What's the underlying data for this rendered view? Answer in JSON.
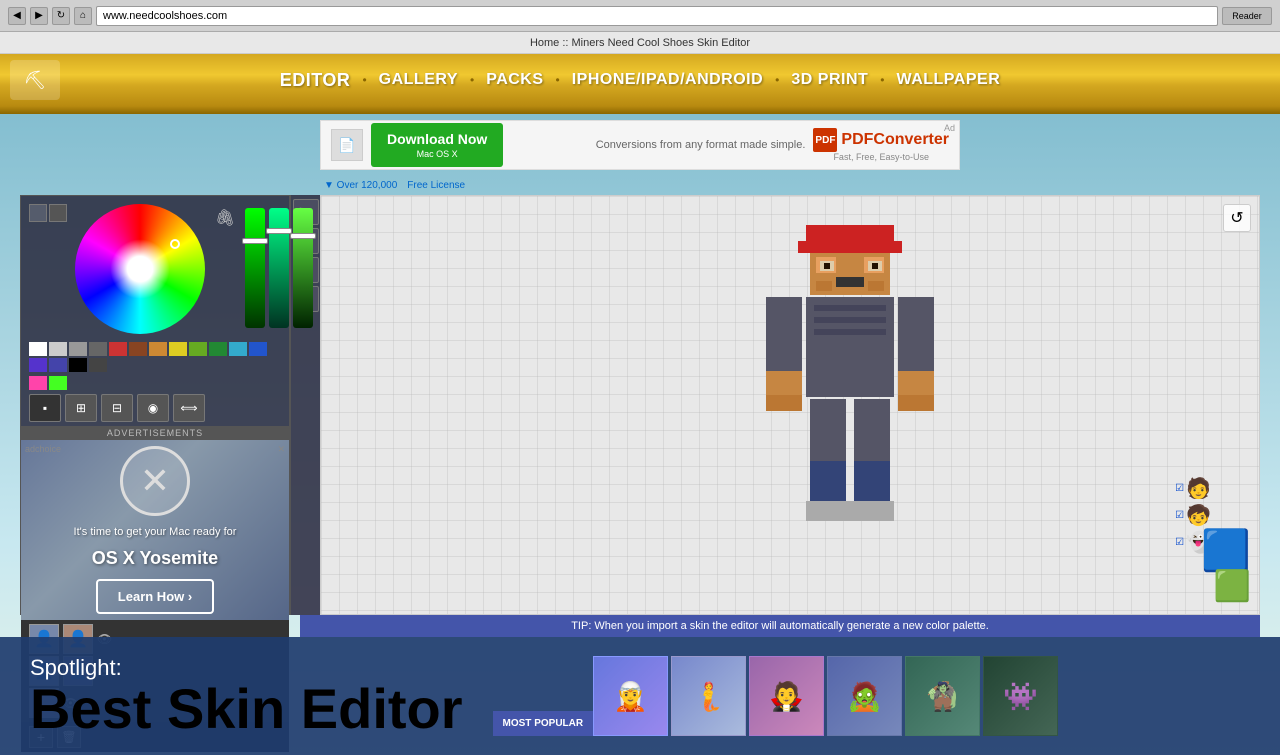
{
  "browser": {
    "url": "www.needcoolshoes.com",
    "title": "Home :: Miners Need Cool Shoes Skin Editor",
    "tab_title": "Home :: Miners Need Cool Shoes Skin Editor"
  },
  "nav": {
    "items": [
      {
        "label": "EDITOR",
        "active": true
      },
      {
        "label": "GALLERY",
        "active": false
      },
      {
        "label": "PACKS",
        "active": false
      },
      {
        "label": "IPHONE/IPAD/ANDROID",
        "active": false
      },
      {
        "label": "3D PRINT",
        "active": false
      },
      {
        "label": "WALLPAPER",
        "active": false
      }
    ]
  },
  "ad_top": {
    "download_label": "Download Now",
    "download_sub": "Mac OS X",
    "download_count": "▼ Over 120,000",
    "free_license": "Free License",
    "ad_text": "Conversions from any format made simple.",
    "product": "PDFConverter",
    "tagline": "Fast, Free, Easy-to-Use",
    "ad_badge": "Ad"
  },
  "editor": {
    "tip_text": "TIP: When you import a skin the editor will automatically generate a new color palette.",
    "reset_label": "↺",
    "add_layer_label": "+",
    "remove_layer_label": "✕",
    "advertisements_label": "ADVERTISEMENTS"
  },
  "ad_left": {
    "label": "ADVERTISEMENTS",
    "close_label": "✕",
    "x_symbol": "✕",
    "ready_text": "It's time to get your Mac ready for",
    "product_title": "OS X Yosemite",
    "cta_label": "Learn How ›"
  },
  "bottom": {
    "spotlight_label": "Spotlight:",
    "main_title": "Best Skin Editor",
    "popular_label": "MOST\nPOPULAR"
  },
  "colors": {
    "nav_gold": "#d4a820",
    "nav_dark": "#8a6600",
    "accent_blue": "#4455aa",
    "editor_bg": "#2a2a3a",
    "green_btn": "#22aa22"
  },
  "tools": {
    "pencil": "✏",
    "select": "⬚",
    "fill": "◈",
    "eyedropper": "⬡",
    "move": "✢",
    "view1": "⊞",
    "view2": "⊟",
    "view3": "⊠",
    "mask": "◉",
    "transform": "⟺",
    "rt_camera": "📷",
    "rt_fill": "🪣",
    "rt_share": "↗",
    "rt_layers": "⊞"
  }
}
